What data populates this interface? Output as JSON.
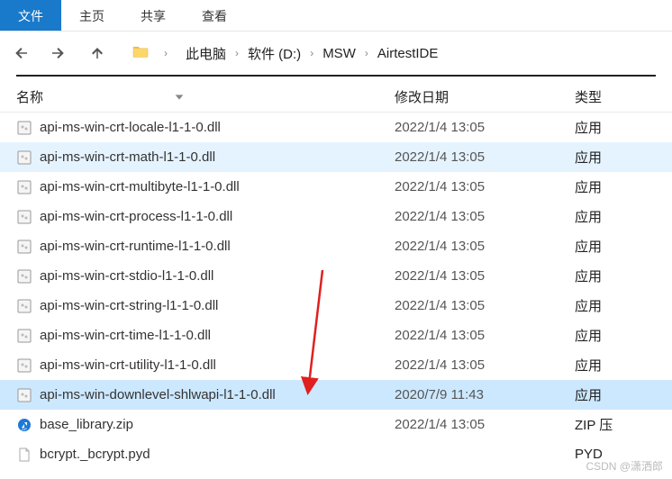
{
  "tabs": [
    {
      "label": "文件",
      "active": true
    },
    {
      "label": "主页"
    },
    {
      "label": "共享"
    },
    {
      "label": "查看"
    }
  ],
  "breadcrumb": {
    "items": [
      "此电脑",
      "软件 (D:)",
      "MSW",
      "AirtestIDE"
    ]
  },
  "columns": {
    "name": "名称",
    "date": "修改日期",
    "type": "类型"
  },
  "files": [
    {
      "icon": "dll",
      "name": "api-ms-win-crt-locale-l1-1-0.dll",
      "date": "2022/1/4 13:05",
      "type": "应用",
      "state": ""
    },
    {
      "icon": "dll",
      "name": "api-ms-win-crt-math-l1-1-0.dll",
      "date": "2022/1/4 13:05",
      "type": "应用",
      "state": "hovered"
    },
    {
      "icon": "dll",
      "name": "api-ms-win-crt-multibyte-l1-1-0.dll",
      "date": "2022/1/4 13:05",
      "type": "应用",
      "state": ""
    },
    {
      "icon": "dll",
      "name": "api-ms-win-crt-process-l1-1-0.dll",
      "date": "2022/1/4 13:05",
      "type": "应用",
      "state": ""
    },
    {
      "icon": "dll",
      "name": "api-ms-win-crt-runtime-l1-1-0.dll",
      "date": "2022/1/4 13:05",
      "type": "应用",
      "state": ""
    },
    {
      "icon": "dll",
      "name": "api-ms-win-crt-stdio-l1-1-0.dll",
      "date": "2022/1/4 13:05",
      "type": "应用",
      "state": ""
    },
    {
      "icon": "dll",
      "name": "api-ms-win-crt-string-l1-1-0.dll",
      "date": "2022/1/4 13:05",
      "type": "应用",
      "state": ""
    },
    {
      "icon": "dll",
      "name": "api-ms-win-crt-time-l1-1-0.dll",
      "date": "2022/1/4 13:05",
      "type": "应用",
      "state": ""
    },
    {
      "icon": "dll",
      "name": "api-ms-win-crt-utility-l1-1-0.dll",
      "date": "2022/1/4 13:05",
      "type": "应用",
      "state": ""
    },
    {
      "icon": "dll",
      "name": "api-ms-win-downlevel-shlwapi-l1-1-0.dll",
      "date": "2020/7/9 11:43",
      "type": "应用",
      "state": "selected"
    },
    {
      "icon": "zip",
      "name": "base_library.zip",
      "date": "2022/1/4 13:05",
      "type": "ZIP 压",
      "state": ""
    },
    {
      "icon": "pyd",
      "name": "bcrypt._bcrypt.pyd",
      "date": "",
      "type": "PYD",
      "state": ""
    }
  ],
  "watermark": "CSDN @潇洒郎"
}
